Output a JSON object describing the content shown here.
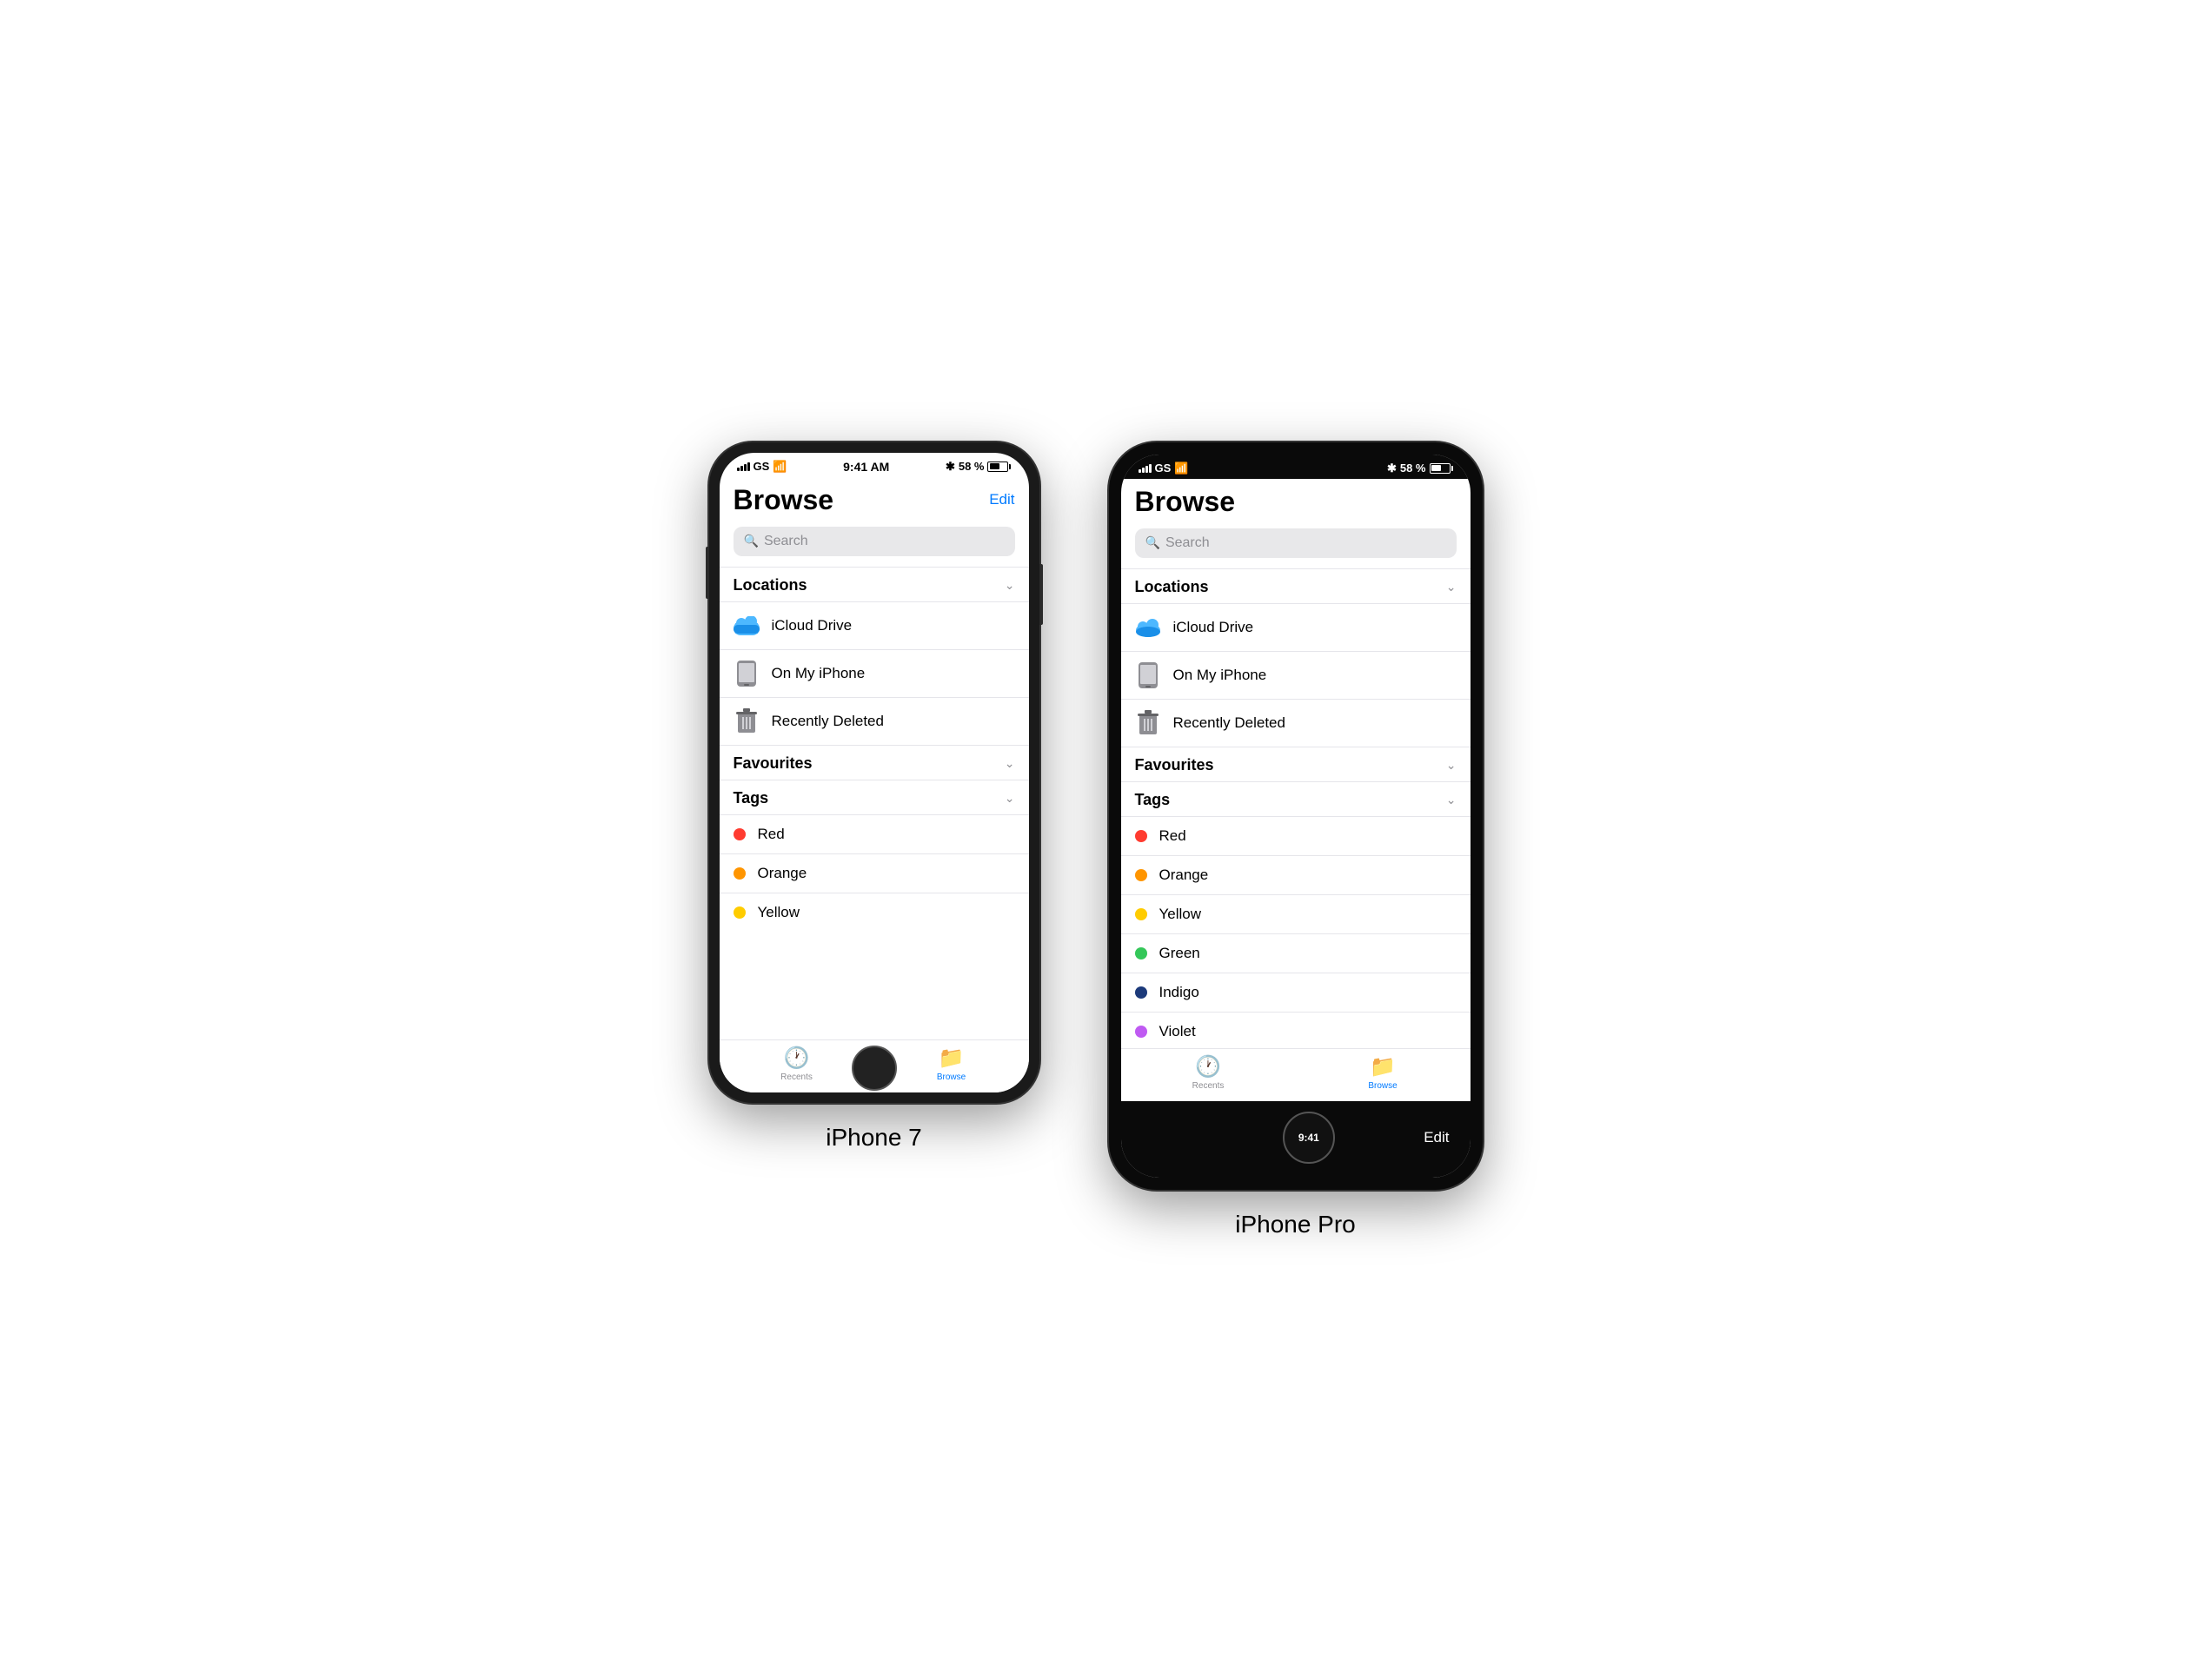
{
  "iphone7": {
    "label": "iPhone 7",
    "status": {
      "signal": "GS",
      "wifi": true,
      "time": "9:41 AM",
      "bluetooth": true,
      "battery": "58 %"
    },
    "app": {
      "title": "Browse",
      "edit_label": "Edit",
      "search_placeholder": "Search",
      "sections": {
        "locations": {
          "title": "Locations",
          "items": [
            {
              "label": "iCloud Drive",
              "icon": "icloud"
            },
            {
              "label": "On My iPhone",
              "icon": "phone"
            },
            {
              "label": "Recently Deleted",
              "icon": "trash"
            }
          ]
        },
        "favourites": {
          "title": "Favourites"
        },
        "tags": {
          "title": "Tags",
          "items": [
            {
              "label": "Red",
              "color": "#ff3b30"
            },
            {
              "label": "Orange",
              "color": "#ff9500"
            },
            {
              "label": "Yellow",
              "color": "#ffcc00"
            }
          ]
        }
      },
      "tabs": [
        {
          "label": "Recents",
          "icon": "🕐",
          "active": false
        },
        {
          "label": "Browse",
          "icon": "📁",
          "active": true
        }
      ]
    }
  },
  "iphonepro": {
    "label": "iPhone Pro",
    "status": {
      "signal": "GS",
      "wifi": true,
      "bluetooth": true,
      "battery": "58 %"
    },
    "app": {
      "title": "Browse",
      "edit_label": "Edit",
      "time": "9:41",
      "search_placeholder": "Search",
      "sections": {
        "locations": {
          "title": "Locations",
          "items": [
            {
              "label": "iCloud Drive",
              "icon": "icloud"
            },
            {
              "label": "On My iPhone",
              "icon": "phone"
            },
            {
              "label": "Recently Deleted",
              "icon": "trash"
            }
          ]
        },
        "favourites": {
          "title": "Favourites"
        },
        "tags": {
          "title": "Tags",
          "items": [
            {
              "label": "Red",
              "color": "#ff3b30"
            },
            {
              "label": "Orange",
              "color": "#ff9500"
            },
            {
              "label": "Yellow",
              "color": "#ffcc00"
            },
            {
              "label": "Green",
              "color": "#34c759"
            },
            {
              "label": "Indigo",
              "color": "#1c3a7a"
            },
            {
              "label": "Violet",
              "color": "#bf5af2"
            }
          ]
        }
      },
      "tabs": [
        {
          "label": "Recents",
          "icon": "🕐",
          "active": false
        },
        {
          "label": "Browse",
          "icon": "📁",
          "active": true
        }
      ]
    }
  }
}
